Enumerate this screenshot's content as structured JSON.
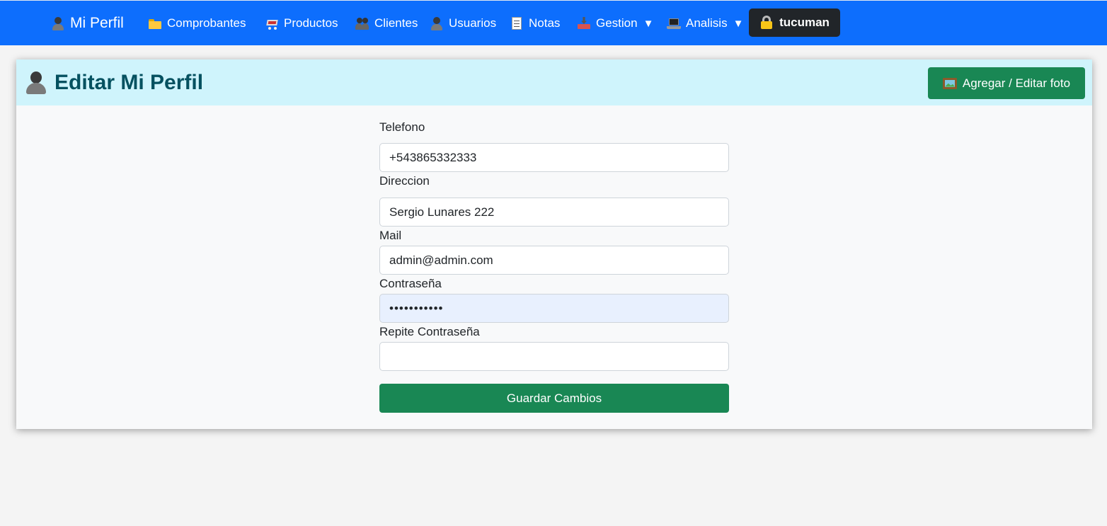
{
  "navbar": {
    "brand": "Mi Perfil",
    "items": [
      {
        "label": "Comprobantes",
        "icon": "folder-icon"
      },
      {
        "label": "Productos",
        "icon": "cart-icon"
      },
      {
        "label": "Clientes",
        "icon": "people-icon"
      },
      {
        "label": "Usuarios",
        "icon": "user-icon"
      },
      {
        "label": "Notas",
        "icon": "memo-icon"
      },
      {
        "label": "Gestion",
        "icon": "inbox-tray-icon",
        "caret": "▼"
      },
      {
        "label": "Analisis",
        "icon": "laptop-icon",
        "caret": "▼"
      }
    ],
    "user": {
      "label": "tucuman",
      "icon": "lock-icon"
    },
    "color": "#0d6efd"
  },
  "card": {
    "title": "Editar Mi Perfil",
    "photo_button": "Agregar / Editar foto",
    "header_color": "#cff4fc",
    "title_color": "#055160"
  },
  "form": {
    "telefono": {
      "label": "Telefono",
      "value": "+543865332333"
    },
    "direccion": {
      "label": "Direccion",
      "value": "Sergio Lunares 222"
    },
    "mail": {
      "label": "Mail",
      "value": "admin@admin.com"
    },
    "password": {
      "label": "Contraseña",
      "value": "12345678901"
    },
    "repeat_password": {
      "label": "Repite Contraseña",
      "value": ""
    },
    "submit": "Guardar Cambios",
    "button_color": "#198754"
  }
}
